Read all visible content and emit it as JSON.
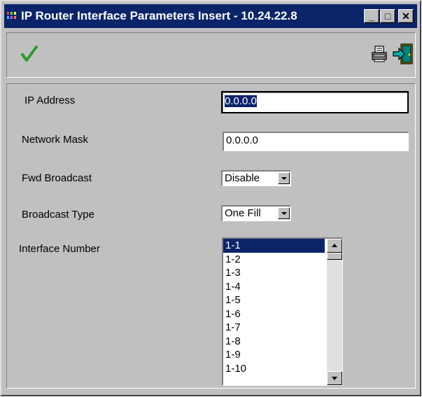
{
  "window": {
    "title": "IP Router Interface Parameters Insert - 10.24.22.8",
    "minimize_glyph": "_",
    "maximize_glyph": "□",
    "close_glyph": "✕"
  },
  "toolbar": {
    "ok_icon": "checkmark-icon",
    "print_icon": "printer-icon",
    "exit_icon": "exit-door-icon"
  },
  "form": {
    "ip_address": {
      "label": "IP Address",
      "value": "0.0.0.0"
    },
    "network_mask": {
      "label": "Network Mask",
      "value": "0.0.0.0"
    },
    "fwd_broadcast": {
      "label": "Fwd Broadcast",
      "value": "Disable"
    },
    "broadcast_type": {
      "label": "Broadcast Type",
      "value": "One Fill"
    },
    "interface_number": {
      "label": "Interface Number",
      "items": [
        "1-1",
        "1-2",
        "1-3",
        "1-4",
        "1-5",
        "1-6",
        "1-7",
        "1-8",
        "1-9",
        "1-10"
      ],
      "selected": "1-1"
    }
  },
  "colors": {
    "titlebar": "#0a246a",
    "face": "#c0c0c0",
    "selection": "#0a246a",
    "check": "#2a9a2a"
  }
}
